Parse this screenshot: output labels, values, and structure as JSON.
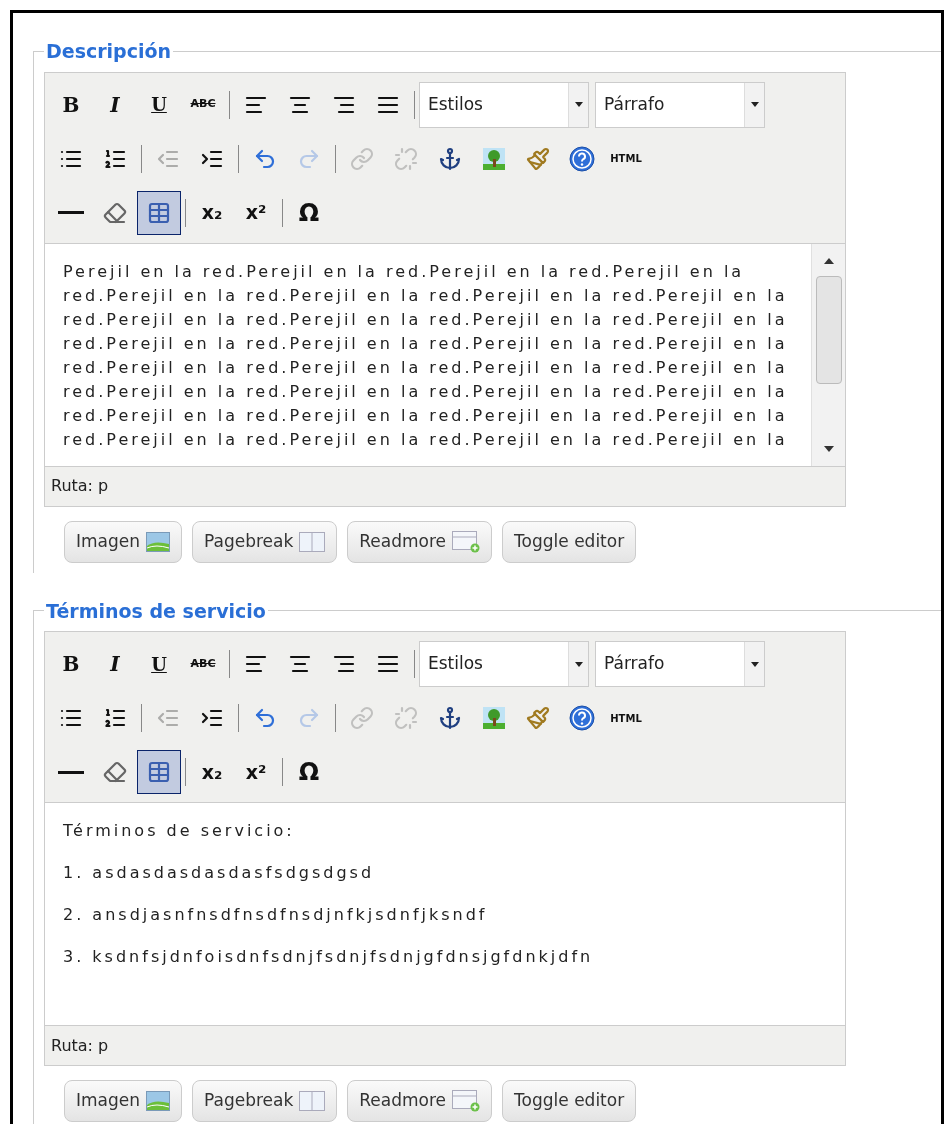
{
  "editors": [
    {
      "legend": "Descripción",
      "scrollable": true,
      "toolbar": [
        [
          {
            "kind": "bold",
            "label": "B",
            "disabled": false,
            "active": false
          },
          {
            "kind": "italic",
            "label": "I",
            "disabled": false,
            "active": false
          },
          {
            "kind": "underline",
            "label": "U",
            "disabled": false,
            "active": false
          },
          {
            "kind": "strike",
            "label": "ABC",
            "disabled": false,
            "active": false
          },
          {
            "kind": "separator"
          },
          {
            "kind": "alignleft",
            "disabled": false,
            "active": false
          },
          {
            "kind": "aligncenter",
            "disabled": false,
            "active": false
          },
          {
            "kind": "alignright",
            "disabled": false,
            "active": false
          },
          {
            "kind": "justify",
            "disabled": false,
            "active": false
          },
          {
            "kind": "separator"
          },
          {
            "kind": "select",
            "value": "Estilos"
          },
          {
            "kind": "select",
            "value": "Párrafo"
          }
        ],
        [
          {
            "kind": "bullets",
            "disabled": false,
            "active": false
          },
          {
            "kind": "numbers",
            "disabled": false,
            "active": false
          },
          {
            "kind": "separator"
          },
          {
            "kind": "outdent",
            "disabled": true,
            "active": false
          },
          {
            "kind": "indent",
            "disabled": false,
            "active": false
          },
          {
            "kind": "separator"
          },
          {
            "kind": "undo",
            "disabled": false,
            "active": false
          },
          {
            "kind": "redo",
            "disabled": true,
            "active": false
          },
          {
            "kind": "separator"
          },
          {
            "kind": "link",
            "disabled": true,
            "active": false
          },
          {
            "kind": "unlink",
            "disabled": true,
            "active": false
          },
          {
            "kind": "anchor",
            "disabled": false,
            "active": false
          },
          {
            "kind": "image",
            "disabled": false,
            "active": false
          },
          {
            "kind": "cleanup",
            "disabled": false,
            "active": false
          },
          {
            "kind": "help",
            "disabled": false,
            "active": false
          },
          {
            "kind": "html",
            "label": "HTML",
            "disabled": false,
            "active": false
          }
        ],
        [
          {
            "kind": "rule",
            "disabled": false,
            "active": false
          },
          {
            "kind": "eraser",
            "disabled": false,
            "active": false
          },
          {
            "kind": "table",
            "disabled": false,
            "active": true
          },
          {
            "kind": "separator"
          },
          {
            "kind": "subscript",
            "label": "x₂",
            "disabled": false,
            "active": false
          },
          {
            "kind": "superscript",
            "label": "x²",
            "disabled": false,
            "active": false
          },
          {
            "kind": "separator"
          },
          {
            "kind": "charmap",
            "label": "Ω",
            "disabled": false,
            "active": false
          }
        ]
      ],
      "content": [
        {
          "lines": [
            "Perejil en la red.Perejil en la red.Perejil en la red.Perejil en la",
            "red.Perejil en la red.Perejil en la red.Perejil en la red.Perejil en la",
            "red.Perejil en la red.Perejil en la red.Perejil en la red.Perejil en la",
            "red.Perejil en la red.Perejil en la red.Perejil en la red.Perejil en la",
            "red.Perejil en la red.Perejil en la red.Perejil en la red.Perejil en la",
            "red.Perejil en la red.Perejil en la red.Perejil en la red.Perejil en la",
            "red.Perejil en la red.Perejil en la red.Perejil en la red.Perejil en la",
            "red.Perejil en la red.Perejil en la red.Perejil en la red.Perejil en la"
          ]
        }
      ],
      "status": "Ruta: p",
      "buttons": [
        {
          "kind": "image",
          "label": "Imagen"
        },
        {
          "kind": "pagebreak",
          "label": "Pagebreak"
        },
        {
          "kind": "readmore",
          "label": "Readmore"
        },
        {
          "kind": "toggle",
          "label": "Toggle editor"
        }
      ]
    },
    {
      "legend": "Términos de servicio",
      "scrollable": false,
      "toolbar": [
        [
          {
            "kind": "bold",
            "label": "B",
            "disabled": false,
            "active": false
          },
          {
            "kind": "italic",
            "label": "I",
            "disabled": false,
            "active": false
          },
          {
            "kind": "underline",
            "label": "U",
            "disabled": false,
            "active": false
          },
          {
            "kind": "strike",
            "label": "ABC",
            "disabled": false,
            "active": false
          },
          {
            "kind": "separator"
          },
          {
            "kind": "alignleft",
            "disabled": false,
            "active": false
          },
          {
            "kind": "aligncenter",
            "disabled": false,
            "active": false
          },
          {
            "kind": "alignright",
            "disabled": false,
            "active": false
          },
          {
            "kind": "justify",
            "disabled": false,
            "active": false
          },
          {
            "kind": "separator"
          },
          {
            "kind": "select",
            "value": "Estilos"
          },
          {
            "kind": "select",
            "value": "Párrafo"
          }
        ],
        [
          {
            "kind": "bullets",
            "disabled": false,
            "active": false
          },
          {
            "kind": "numbers",
            "disabled": false,
            "active": false
          },
          {
            "kind": "separator"
          },
          {
            "kind": "outdent",
            "disabled": true,
            "active": false
          },
          {
            "kind": "indent",
            "disabled": false,
            "active": false
          },
          {
            "kind": "separator"
          },
          {
            "kind": "undo",
            "disabled": false,
            "active": false
          },
          {
            "kind": "redo",
            "disabled": true,
            "active": false
          },
          {
            "kind": "separator"
          },
          {
            "kind": "link",
            "disabled": true,
            "active": false
          },
          {
            "kind": "unlink",
            "disabled": true,
            "active": false
          },
          {
            "kind": "anchor",
            "disabled": false,
            "active": false
          },
          {
            "kind": "image",
            "disabled": false,
            "active": false
          },
          {
            "kind": "cleanup",
            "disabled": false,
            "active": false
          },
          {
            "kind": "help",
            "disabled": false,
            "active": false
          },
          {
            "kind": "html",
            "label": "HTML",
            "disabled": false,
            "active": false
          }
        ],
        [
          {
            "kind": "rule",
            "disabled": false,
            "active": false
          },
          {
            "kind": "eraser",
            "disabled": false,
            "active": false
          },
          {
            "kind": "table",
            "disabled": false,
            "active": true
          },
          {
            "kind": "separator"
          },
          {
            "kind": "subscript",
            "label": "x₂",
            "disabled": false,
            "active": false
          },
          {
            "kind": "superscript",
            "label": "x²",
            "disabled": false,
            "active": false
          },
          {
            "kind": "separator"
          },
          {
            "kind": "charmap",
            "label": "Ω",
            "disabled": false,
            "active": false
          }
        ]
      ],
      "content": [
        {
          "lines": [
            "Términos de servicio:"
          ]
        },
        {
          "lines": [
            "1. asdasdasdasdasfsdgsdgsd"
          ]
        },
        {
          "lines": [
            "2. ansdjasnfnsdfnsdfnsdjnfkjsdnfjksndf"
          ]
        },
        {
          "lines": [
            "3. ksdnfsjdnfoisdnfsdnjfsdnjfsdnjgfdnsjgfdnkjdfn"
          ]
        }
      ],
      "status": "Ruta: p",
      "buttons": [
        {
          "kind": "image",
          "label": "Imagen"
        },
        {
          "kind": "pagebreak",
          "label": "Pagebreak"
        },
        {
          "kind": "readmore",
          "label": "Readmore"
        },
        {
          "kind": "toggle",
          "label": "Toggle editor"
        }
      ]
    }
  ]
}
